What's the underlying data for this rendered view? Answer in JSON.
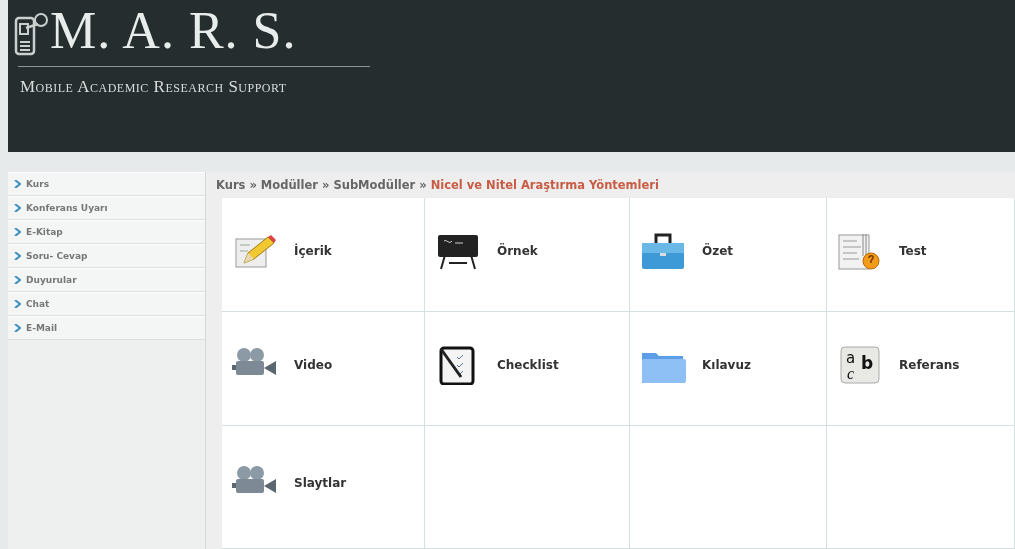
{
  "header": {
    "title": "M. A. R. S.",
    "subtitle": "Mobile Academic Research Support"
  },
  "sidebar": {
    "items": [
      {
        "label": "Kurs"
      },
      {
        "label": "Konferans Uyarı"
      },
      {
        "label": "E-Kitap"
      },
      {
        "label": "Soru- Cevap"
      },
      {
        "label": "Duyurular"
      },
      {
        "label": "Chat"
      },
      {
        "label": "E-Mail"
      }
    ]
  },
  "breadcrumb": {
    "items": [
      "Kurs",
      "Modüller",
      "SubModüller"
    ],
    "separator": "»",
    "current": "Nicel ve Nitel Araştırma Yöntemleri"
  },
  "modules": [
    {
      "label": "İçerik",
      "kind": "edit"
    },
    {
      "label": "Örnek",
      "kind": "board"
    },
    {
      "label": "Özet",
      "kind": "briefcase"
    },
    {
      "label": "Test",
      "kind": "test"
    },
    {
      "label": "Video",
      "kind": "video"
    },
    {
      "label": "Checklist",
      "kind": "checklist"
    },
    {
      "label": "Kılavuz",
      "kind": "folder"
    },
    {
      "label": "Referans",
      "kind": "letters",
      "letters": [
        "a",
        "c",
        "b"
      ]
    },
    {
      "label": "Slaytlar",
      "kind": "video"
    }
  ]
}
